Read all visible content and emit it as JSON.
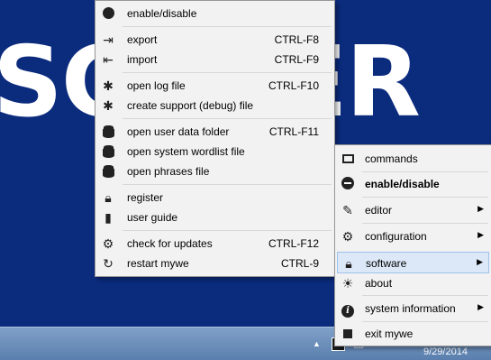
{
  "desktop": {
    "banner_text": "SCOPER"
  },
  "main_menu": {
    "items": [
      {
        "label": "enable/disable",
        "shortcut": "",
        "icon": "globe-icon"
      },
      {
        "label": "export",
        "shortcut": "CTRL-F8",
        "icon": "export-icon"
      },
      {
        "label": "import",
        "shortcut": "CTRL-F9",
        "icon": "import-icon"
      },
      {
        "label": "open log file",
        "shortcut": "CTRL-F10",
        "icon": "bug-icon"
      },
      {
        "label": "create support (debug) file",
        "shortcut": "",
        "icon": "bug-icon"
      },
      {
        "label": "open user data folder",
        "shortcut": "CTRL-F11",
        "icon": "database-icon"
      },
      {
        "label": "open system wordlist file",
        "shortcut": "",
        "icon": "database-icon"
      },
      {
        "label": "open phrases file",
        "shortcut": "",
        "icon": "database-icon"
      },
      {
        "label": "register",
        "shortcut": "",
        "icon": "lock-icon"
      },
      {
        "label": "user guide",
        "shortcut": "",
        "icon": "book-icon"
      },
      {
        "label": "check for updates",
        "shortcut": "CTRL-F12",
        "icon": "gear-icon"
      },
      {
        "label": "restart mywe",
        "shortcut": "CTRL-9",
        "icon": "restart-icon"
      }
    ]
  },
  "sub_menu": {
    "items": [
      {
        "label": "commands",
        "icon": "commands-icon",
        "has_submenu": false
      },
      {
        "label": "enable/disable",
        "icon": "disable-icon",
        "has_submenu": false,
        "bold": true
      },
      {
        "label": "editor",
        "icon": "editor-icon",
        "has_submenu": true
      },
      {
        "label": "configuration",
        "icon": "gear-icon",
        "has_submenu": true
      },
      {
        "label": "software",
        "icon": "lock-icon",
        "has_submenu": true,
        "highlighted": true
      },
      {
        "label": "about",
        "icon": "sun-icon",
        "has_submenu": false
      },
      {
        "label": "system information",
        "icon": "info-icon",
        "has_submenu": true
      },
      {
        "label": "exit mywe",
        "icon": "stop-icon",
        "has_submenu": false
      }
    ],
    "arrow": "▶"
  },
  "taskbar": {
    "date": "9/29/2014",
    "tray_chevron": "▲"
  },
  "colors": {
    "desktop": "#0b2b7d",
    "menu_bg": "#f2f2f2",
    "highlight": "#dce8f7"
  }
}
